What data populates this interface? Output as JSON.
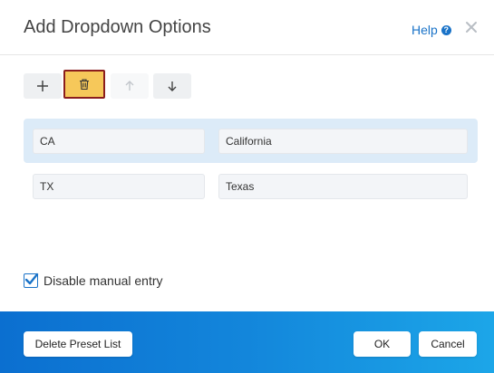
{
  "dialog": {
    "title": "Add Dropdown Options",
    "help_label": "Help",
    "help_icon": "question-circle-icon",
    "close_icon": "close-icon"
  },
  "toolbar": {
    "add_icon": "plus-icon",
    "delete_icon": "trash-icon",
    "up_icon": "arrow-up-icon",
    "down_icon": "arrow-down-icon"
  },
  "options": [
    {
      "value": "CA",
      "label": "California"
    },
    {
      "value": "TX",
      "label": "Texas"
    }
  ],
  "manual_entry": {
    "label": "Disable manual entry",
    "checked": true
  },
  "footer": {
    "delete_preset_label": "Delete Preset List",
    "ok_label": "OK",
    "cancel_label": "Cancel"
  },
  "colors": {
    "accent": "#1a73c8",
    "selected_row": "#dcebf8",
    "delete_highlight": "#f6c85a",
    "delete_border": "#8b1d1d",
    "footer_gradient_start": "#0b6fd0",
    "footer_gradient_end": "#1ca6e8"
  }
}
